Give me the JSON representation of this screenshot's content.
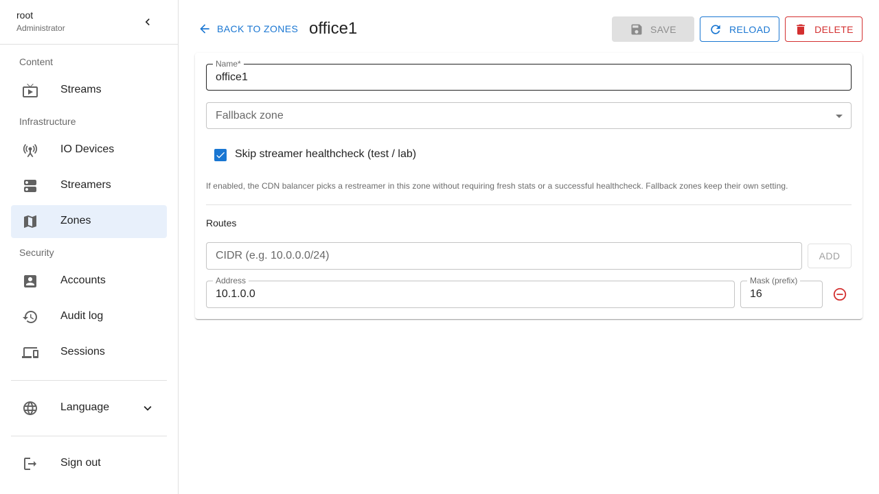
{
  "user": {
    "name": "root",
    "role": "Administrator"
  },
  "sidebar": {
    "sections": [
      {
        "label": "Content"
      },
      {
        "label": "Infrastructure"
      },
      {
        "label": "Security"
      }
    ],
    "items": [
      {
        "label": "Streams",
        "icon": "tv-icon"
      },
      {
        "label": "IO Devices",
        "icon": "antenna-icon"
      },
      {
        "label": "Streamers",
        "icon": "server-icon"
      },
      {
        "label": "Zones",
        "icon": "map-icon",
        "active": true
      },
      {
        "label": "Accounts",
        "icon": "account-box-icon"
      },
      {
        "label": "Audit log",
        "icon": "history-icon"
      },
      {
        "label": "Sessions",
        "icon": "devices-icon"
      }
    ],
    "language_label": "Language",
    "signout_label": "Sign out"
  },
  "header": {
    "back_label": "BACK TO ZONES",
    "title": "office1",
    "save_label": "SAVE",
    "reload_label": "RELOAD",
    "delete_label": "DELETE"
  },
  "form": {
    "name_label": "Name",
    "name_required_mark": "*",
    "name_value": "office1",
    "fallback_placeholder": "Fallback zone",
    "skip_check_label": "Skip streamer healthcheck (test / lab)",
    "skip_check_checked": true,
    "helper": "If enabled, the CDN balancer picks a restreamer in this zone without requiring fresh stats or a successful healthcheck. Fallback zones keep their own setting.",
    "routes_label": "Routes",
    "cidr_placeholder": "CIDR (e.g. 10.0.0.0/24)",
    "add_label": "ADD",
    "route": {
      "address_label": "Address",
      "address_value": "10.1.0.0",
      "mask_label": "Mask (prefix)",
      "mask_value": "16"
    }
  },
  "colors": {
    "primary": "#1976d2",
    "danger": "#d32f2f",
    "active_bg": "#e8f0fb"
  }
}
